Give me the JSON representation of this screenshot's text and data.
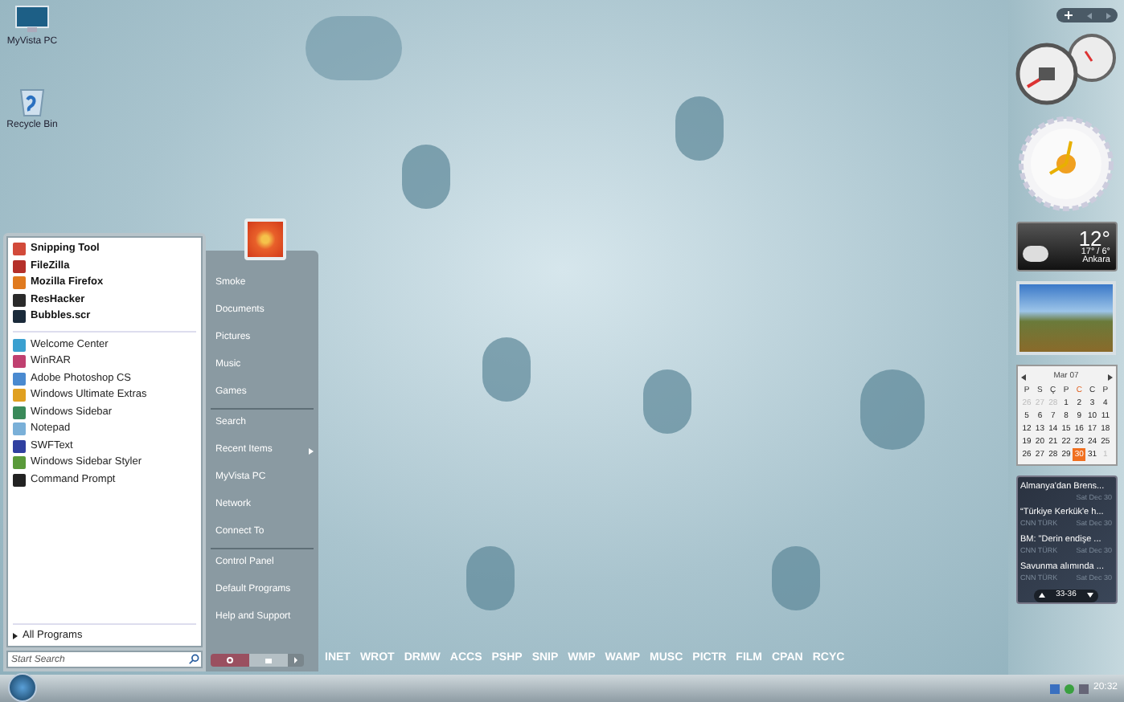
{
  "desktop_icons": [
    {
      "label": "MyVista PC",
      "kind": "computer"
    },
    {
      "label": "Recycle Bin",
      "kind": "bin"
    }
  ],
  "start_menu": {
    "pinned": [
      {
        "label": "Snipping Tool",
        "color": "#d24a3a"
      },
      {
        "label": "FileZilla",
        "color": "#b5302a"
      },
      {
        "label": "Mozilla Firefox",
        "color": "#e07a1f"
      },
      {
        "label": "ResHacker",
        "color": "#2a2a2a"
      },
      {
        "label": "Bubbles.scr",
        "color": "#1a2a3a"
      }
    ],
    "recent": [
      {
        "label": "Welcome Center",
        "color": "#3aa0d0"
      },
      {
        "label": "WinRAR",
        "color": "#c04070"
      },
      {
        "label": "Adobe Photoshop CS",
        "color": "#4a8ad0"
      },
      {
        "label": "Windows Ultimate Extras",
        "color": "#e0a020"
      },
      {
        "label": "Windows Sidebar",
        "color": "#3a8a5a"
      },
      {
        "label": "Notepad",
        "color": "#7ab0d8"
      },
      {
        "label": "SWFText",
        "color": "#3040a0"
      },
      {
        "label": "Windows Sidebar Styler",
        "color": "#5a9a3a"
      },
      {
        "label": "Command Prompt",
        "color": "#222222"
      }
    ],
    "all_programs": "All Programs",
    "search": {
      "placeholder": "Start Search"
    },
    "places": [
      [
        {
          "label": "Smoke",
          "kind": "link"
        },
        {
          "label": "Documents",
          "kind": "link"
        },
        {
          "label": "Pictures",
          "kind": "link"
        },
        {
          "label": "Music",
          "kind": "link"
        },
        {
          "label": "Games",
          "kind": "link"
        }
      ],
      [
        {
          "label": "Search",
          "kind": "link"
        },
        {
          "label": "Recent Items",
          "kind": "submenu"
        },
        {
          "label": "MyVista PC",
          "kind": "link"
        },
        {
          "label": "Network",
          "kind": "link"
        },
        {
          "label": "Connect To",
          "kind": "link"
        }
      ],
      [
        {
          "label": "Control Panel",
          "kind": "link"
        },
        {
          "label": "Default Programs",
          "kind": "link"
        },
        {
          "label": "Help and Support",
          "kind": "link"
        }
      ]
    ]
  },
  "quick_launch": [
    "INET",
    "WROT",
    "DRMW",
    "ACCS",
    "PSHP",
    "SNIP",
    "WMP",
    "WAMP",
    "MUSC",
    "PICTR",
    "FILM",
    "CPAN",
    "RCYC"
  ],
  "sidebar": {
    "weather": {
      "temperature": "12°",
      "range": "17° / 6°",
      "city": "Ankara"
    },
    "calendar": {
      "month": "Mar 07",
      "weekdays": [
        "P",
        "S",
        "Ç",
        "P",
        "C",
        "C",
        "P"
      ],
      "weeks": [
        [
          {
            "day": "26",
            "muted": true,
            "selected": false
          },
          {
            "day": "27",
            "muted": true,
            "selected": false
          },
          {
            "day": "28",
            "muted": true,
            "selected": false
          },
          {
            "day": "1",
            "muted": false,
            "selected": false
          },
          {
            "day": "2",
            "muted": false,
            "selected": false
          },
          {
            "day": "3",
            "muted": false,
            "selected": false
          },
          {
            "day": "4",
            "muted": false,
            "selected": false
          }
        ],
        [
          {
            "day": "5",
            "muted": false,
            "selected": false
          },
          {
            "day": "6",
            "muted": false,
            "selected": false
          },
          {
            "day": "7",
            "muted": false,
            "selected": false
          },
          {
            "day": "8",
            "muted": false,
            "selected": false
          },
          {
            "day": "9",
            "muted": false,
            "selected": false
          },
          {
            "day": "10",
            "muted": false,
            "selected": false
          },
          {
            "day": "11",
            "muted": false,
            "selected": false
          }
        ],
        [
          {
            "day": "12",
            "muted": false,
            "selected": false
          },
          {
            "day": "13",
            "muted": false,
            "selected": false
          },
          {
            "day": "14",
            "muted": false,
            "selected": false
          },
          {
            "day": "15",
            "muted": false,
            "selected": false
          },
          {
            "day": "16",
            "muted": false,
            "selected": false
          },
          {
            "day": "17",
            "muted": false,
            "selected": false
          },
          {
            "day": "18",
            "muted": false,
            "selected": false
          }
        ],
        [
          {
            "day": "19",
            "muted": false,
            "selected": false
          },
          {
            "day": "20",
            "muted": false,
            "selected": false
          },
          {
            "day": "21",
            "muted": false,
            "selected": false
          },
          {
            "day": "22",
            "muted": false,
            "selected": false
          },
          {
            "day": "23",
            "muted": false,
            "selected": false
          },
          {
            "day": "24",
            "muted": false,
            "selected": false
          },
          {
            "day": "25",
            "muted": false,
            "selected": false
          }
        ],
        [
          {
            "day": "26",
            "muted": false,
            "selected": false
          },
          {
            "day": "27",
            "muted": false,
            "selected": false
          },
          {
            "day": "28",
            "muted": false,
            "selected": false
          },
          {
            "day": "29",
            "muted": false,
            "selected": false
          },
          {
            "day": "30",
            "muted": false,
            "selected": true
          },
          {
            "day": "31",
            "muted": false,
            "selected": false
          },
          {
            "day": "1",
            "muted": true,
            "selected": false
          }
        ]
      ]
    },
    "news": {
      "items": [
        {
          "title": "Almanya'dan Brens...",
          "date": "Sat Dec 30"
        },
        {
          "title": "“Türkiye Kerkük'e h...",
          "source": "CNN TÜRK",
          "date": "Sat Dec 30"
        },
        {
          "title": "BM: \"Derin endişe ...",
          "source": "CNN TÜRK",
          "date": "Sat Dec 30"
        },
        {
          "title": "Savunma alımında ...",
          "source": "CNN TÜRK",
          "date": "Sat Dec 30"
        }
      ],
      "page": "33-36"
    }
  },
  "taskbar": {
    "clock": "20:32"
  }
}
